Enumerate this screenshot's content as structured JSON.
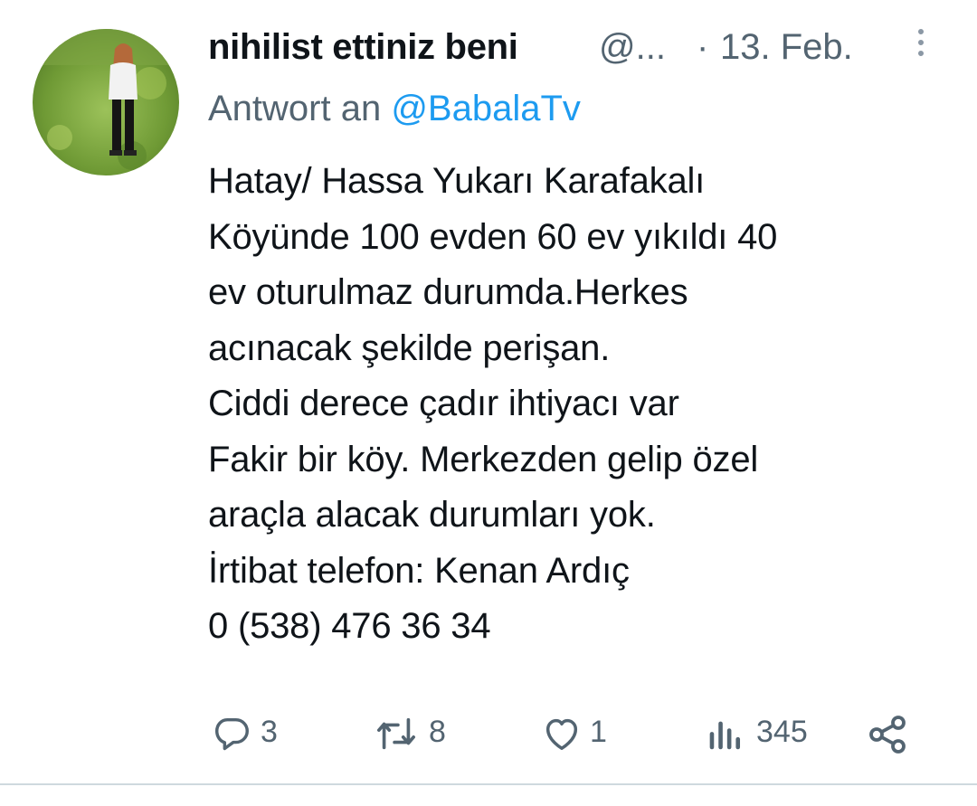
{
  "tweet": {
    "author": {
      "display_name": "nihilist ettiniz beni",
      "handle": "@...",
      "avatar_alt": "profile-photo"
    },
    "separator": "·",
    "date": "13. Feb.",
    "reply_to": {
      "prefix": "Antwort an ",
      "mention": "@BabalaTv"
    },
    "text_lines": [
      "Hatay/ Hassa Yukarı Karafakalı",
      "Köyünde 100 evden 60 ev yıkıldı 40",
      "ev oturulmaz durumda.Herkes",
      "acınacak şekilde perişan.",
      "Ciddi derece çadır ihtiyacı var",
      "Fakir bir köy. Merkezden gelip özel",
      "araçla alacak durumları yok.",
      "İrtibat telefon: Kenan Ardıç",
      "0 (538) 476 36 34"
    ],
    "actions": {
      "replies": {
        "icon": "reply-icon",
        "count": "3"
      },
      "retweets": {
        "icon": "retweet-icon",
        "count": "8"
      },
      "likes": {
        "icon": "heart-icon",
        "count": "1"
      },
      "views": {
        "icon": "views-icon",
        "count": "345"
      },
      "share": {
        "icon": "share-icon"
      }
    }
  },
  "colors": {
    "primary_text": "#0f1419",
    "secondary_text": "#536471",
    "accent": "#1d9bf0",
    "icon_gray": "#536471"
  }
}
